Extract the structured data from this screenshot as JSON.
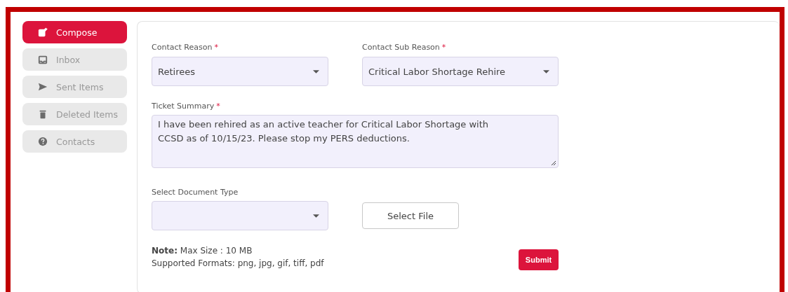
{
  "sidebar": {
    "items": [
      {
        "label": "Compose",
        "kind": "compose",
        "selected": true
      },
      {
        "label": "Inbox",
        "kind": "inbox",
        "selected": false
      },
      {
        "label": "Sent Items",
        "kind": "send",
        "selected": false
      },
      {
        "label": "Deleted Items",
        "kind": "trash",
        "selected": false
      },
      {
        "label": "Contacts",
        "kind": "help",
        "selected": false
      }
    ]
  },
  "form": {
    "contact_reason": {
      "label": "Contact Reason",
      "required_mark": "*",
      "value": "Retirees"
    },
    "contact_sub_reason": {
      "label": "Contact Sub Reason",
      "required_mark": "*",
      "value": "Critical Labor Shortage Rehire"
    },
    "ticket_summary": {
      "label": "Ticket Summary",
      "required_mark": "*",
      "value": "I have been rehired as an active teacher for Critical Labor Shortage with CCSD as of 10/15/23. Please stop my PERS deductions."
    },
    "document_type": {
      "label": "Select Document Type"
    },
    "select_file_button": "Select File",
    "note": "**Note:** Max Size : 10 MB",
    "formats": "Supported Formats: png, jpg, gif, tiff, pdf",
    "submit_button": "Submit"
  }
}
